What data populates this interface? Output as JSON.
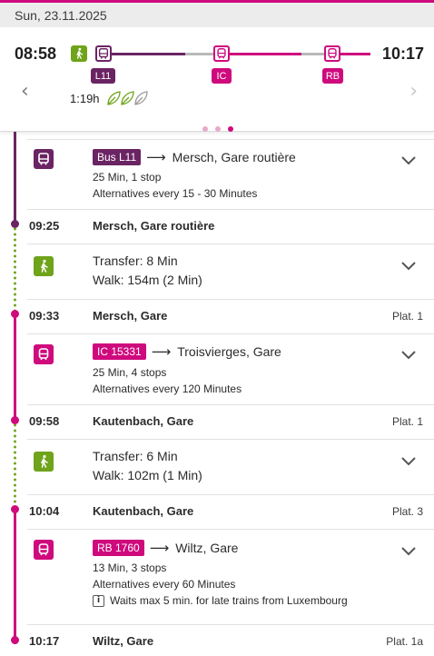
{
  "header": {
    "date": "Sun, 23.11.2025"
  },
  "summary": {
    "departure_time": "08:58",
    "arrival_time": "10:17",
    "duration": "1:19h",
    "legs": [
      {
        "type": "walk",
        "icon": "walking-person-icon"
      },
      {
        "type": "bus",
        "label": "L11",
        "icon": "bus-icon"
      },
      {
        "type": "train",
        "label": "IC",
        "icon": "train-icon"
      },
      {
        "type": "train",
        "label": "RB",
        "icon": "train-icon"
      }
    ],
    "eco_leaves": 3,
    "page_count": 3,
    "active_page": 3,
    "prev_arrow": "‹",
    "next_arrow": "›"
  },
  "colors": {
    "bus": "#6b2463",
    "train": "#cf0a7d",
    "walk": "#6ea31a",
    "date_bar": "#ececec",
    "inactive_dot": "#e8a9cc"
  },
  "itinerary": {
    "legs": [
      {
        "kind": "bus",
        "badge": "Bus L11",
        "destination": "Mersch, Gare routière",
        "duration_stops": "25 Min, 1 stop",
        "alternatives": "Alternatives every 15 - 30 Minutes"
      },
      {
        "kind": "walk",
        "transfer": "Transfer: 8 Min",
        "walk": "Walk: 154m (2 Min)"
      },
      {
        "kind": "train",
        "badge": "IC 15331",
        "destination": "Troisvierges, Gare",
        "duration_stops": "25 Min, 4 stops",
        "alternatives": "Alternatives every 120 Minutes"
      },
      {
        "kind": "walk",
        "transfer": "Transfer: 6 Min",
        "walk": "Walk: 102m (1 Min)"
      },
      {
        "kind": "train",
        "badge": "RB 1760",
        "destination": "Wiltz, Gare",
        "duration_stops": "13 Min, 3 stops",
        "alternatives": "Alternatives every 60 Minutes",
        "info_icon": "i",
        "info": "Waits max 5 min. for late trains from Luxembourg"
      }
    ],
    "stops": [
      {
        "time": "09:25",
        "name": "Mersch, Gare routière",
        "platform": ""
      },
      {
        "time": "09:33",
        "name": "Mersch, Gare",
        "platform": "Plat. 1"
      },
      {
        "time": "09:58",
        "name": "Kautenbach, Gare",
        "platform": "Plat. 1"
      },
      {
        "time": "10:04",
        "name": "Kautenbach, Gare",
        "platform": "Plat. 3"
      },
      {
        "time": "10:17",
        "name": "Wiltz, Gare",
        "platform": "Plat. 1a"
      }
    ]
  }
}
